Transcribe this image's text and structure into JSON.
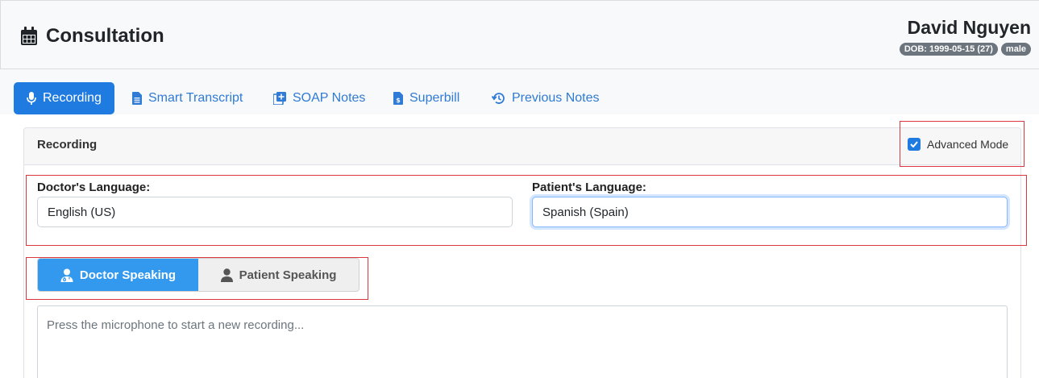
{
  "header": {
    "title": "Consultation",
    "title_icon": "calendar-icon",
    "patient_name": "David Nguyen",
    "dob_badge": "DOB: 1999-05-15 (27)",
    "sex_badge": "male"
  },
  "tabs": [
    {
      "label": "Recording",
      "icon": "microphone-icon",
      "active": true
    },
    {
      "label": "Smart Transcript",
      "icon": "document-icon",
      "active": false
    },
    {
      "label": "SOAP Notes",
      "icon": "notes-plus-icon",
      "active": false
    },
    {
      "label": "Superbill",
      "icon": "invoice-icon",
      "active": false
    },
    {
      "label": "Previous Notes",
      "icon": "history-icon",
      "active": false
    }
  ],
  "recording_card": {
    "title": "Recording",
    "advanced_mode_label": "Advanced Mode",
    "advanced_mode_checked": true,
    "doctor_language_label": "Doctor's Language:",
    "doctor_language_value": "English (US)",
    "patient_language_label": "Patient's Language:",
    "patient_language_value": "Spanish (Spain)",
    "speakers": [
      {
        "label": "Doctor Speaking",
        "icon": "doctor-icon",
        "active": true
      },
      {
        "label": "Patient Speaking",
        "icon": "user-icon",
        "active": false
      }
    ],
    "transcript_placeholder": "Press the microphone to start a new recording..."
  },
  "colors": {
    "primary": "#1f7be0",
    "speaker_active": "#3399ee",
    "annotation": "#d9363e"
  }
}
